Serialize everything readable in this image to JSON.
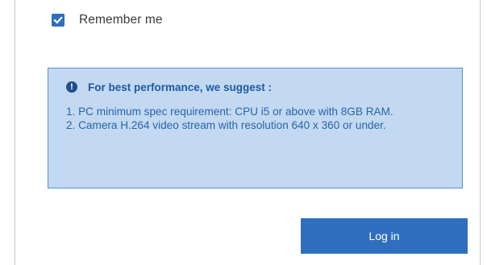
{
  "remember": {
    "label": "Remember me",
    "checked": true
  },
  "notice": {
    "icon": "info-icon",
    "icon_glyph": "!",
    "title": "For best performance, we suggest :",
    "items": [
      "1. PC minimum spec requirement: CPU i5 or above with 8GB RAM.",
      "2. Camera H.264 video stream with resolution 640 x 360 or under."
    ]
  },
  "login": {
    "label": "Log in"
  },
  "colors": {
    "accent": "#2f6fbd",
    "notice_bg": "#c2d9f1",
    "notice_border": "#5b8fcf"
  }
}
